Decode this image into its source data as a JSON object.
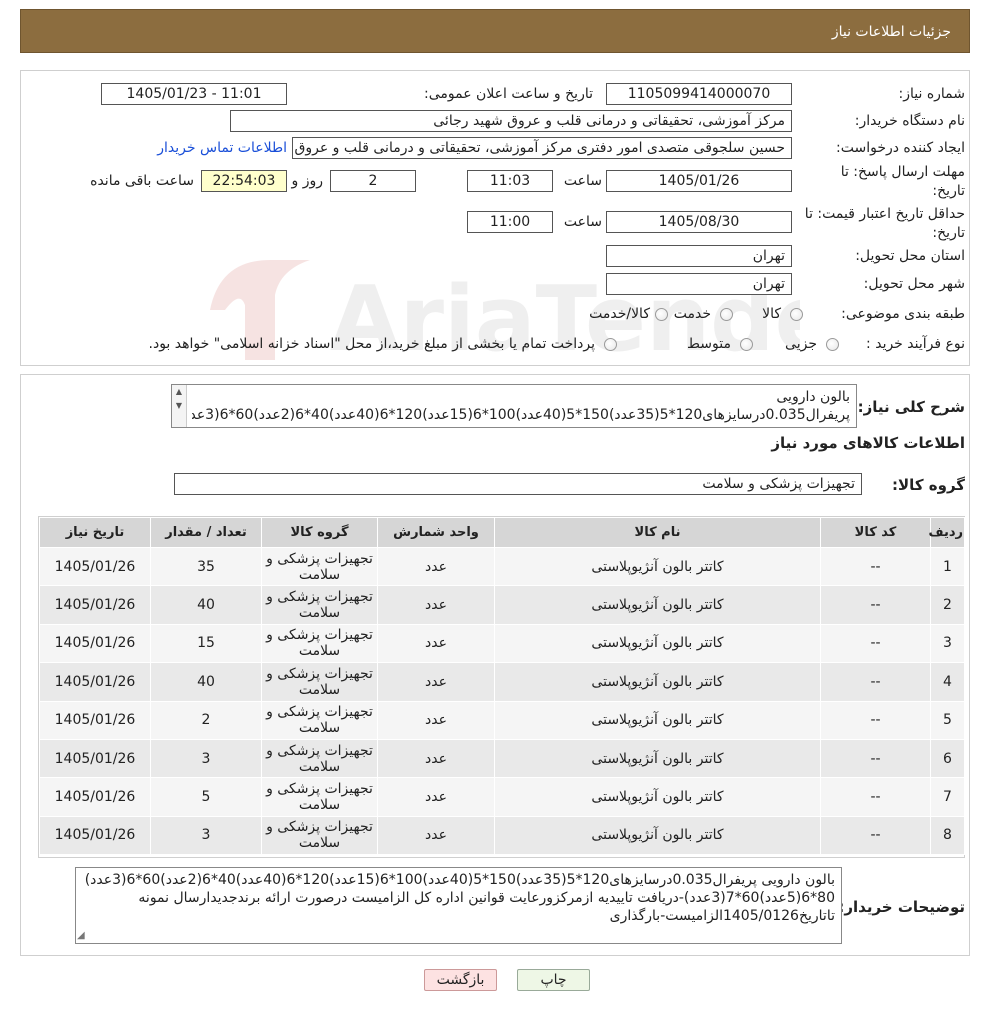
{
  "header": {
    "title": "جزئیات اطلاعات نیاز"
  },
  "info": {
    "need_number_label": "شماره نیاز:",
    "need_number": "1105099414000070",
    "announce_label": "تاریخ و ساعت اعلان عمومی:",
    "announce_value": "1405/01/23 - 11:01",
    "buyer_org_label": "نام دستگاه خریدار:",
    "buyer_org": "مرکز آموزشی، تحقیقاتی و درمانی قلب و عروق شهید رجائی",
    "creator_label": "ایجاد کننده درخواست:",
    "creator": "حسین سلجوقی متصدی امور دفتری مرکز آموزشی، تحقیقاتی و درمانی قلب و عروق",
    "contact_link": "اطلاعات تماس خریدار",
    "deadline_label_1": "مهلت ارسال پاسخ: تا",
    "deadline_label_2": "تاریخ:",
    "deadline_date": "1405/01/26",
    "time_label": "ساعت",
    "deadline_time": "11:03",
    "days_value": "2",
    "days_label": "روز و",
    "remaining_value": "22:54:03",
    "remaining_label": "ساعت باقی مانده",
    "validity_label_1": "حداقل تاریخ اعتبار قیمت: تا",
    "validity_label_2": "تاریخ:",
    "validity_date": "1405/08/30",
    "validity_time": "11:00",
    "province_label": "استان محل تحویل:",
    "province": "تهران",
    "city_label": "شهر محل تحویل:",
    "city": "تهران",
    "category_label": "طبقه بندی موضوعی:",
    "category_options": [
      "کالا",
      "خدمت",
      "کالا/خدمت"
    ],
    "process_label": "نوع فرآیند خرید :",
    "process_options": [
      "جزیی",
      "متوسط"
    ],
    "process_note": "پرداخت تمام یا بخشی از مبلغ خرید،از محل \"اسناد خزانه اسلامی\" خواهد بود."
  },
  "summary": {
    "label": "شرح کلی نیاز:",
    "line1": "بالون دارویی",
    "line2": "پریفرال0.035درسایزهای120*5(35عدد)150*5(40عدد)100*6(15عدد)120*6(40عدد)40*6(2عدد)60*6(3عد",
    "goods_info_title": "اطلاعات کالاهای مورد نیاز",
    "goods_group_label": "گروه کالا:",
    "goods_group": "تجهیزات پزشکی و سلامت"
  },
  "table": {
    "headers": [
      "ردیف",
      "کد کالا",
      "نام کالا",
      "واحد شمارش",
      "گروه کالا",
      "تعداد / مقدار",
      "تاریخ نیاز"
    ],
    "rows": [
      {
        "idx": "1",
        "code": "--",
        "name": "کاتتر بالون آنژیوپلاستی",
        "unit": "عدد",
        "group": "تجهیزات پزشکی و سلامت",
        "qty": "35",
        "date": "1405/01/26"
      },
      {
        "idx": "2",
        "code": "--",
        "name": "کاتتر بالون آنژیوپلاستی",
        "unit": "عدد",
        "group": "تجهیزات پزشکی و سلامت",
        "qty": "40",
        "date": "1405/01/26"
      },
      {
        "idx": "3",
        "code": "--",
        "name": "کاتتر بالون آنژیوپلاستی",
        "unit": "عدد",
        "group": "تجهیزات پزشکی و سلامت",
        "qty": "15",
        "date": "1405/01/26"
      },
      {
        "idx": "4",
        "code": "--",
        "name": "کاتتر بالون آنژیوپلاستی",
        "unit": "عدد",
        "group": "تجهیزات پزشکی و سلامت",
        "qty": "40",
        "date": "1405/01/26"
      },
      {
        "idx": "5",
        "code": "--",
        "name": "کاتتر بالون آنژیوپلاستی",
        "unit": "عدد",
        "group": "تجهیزات پزشکی و سلامت",
        "qty": "2",
        "date": "1405/01/26"
      },
      {
        "idx": "6",
        "code": "--",
        "name": "کاتتر بالون آنژیوپلاستی",
        "unit": "عدد",
        "group": "تجهیزات پزشکی و سلامت",
        "qty": "3",
        "date": "1405/01/26"
      },
      {
        "idx": "7",
        "code": "--",
        "name": "کاتتر بالون آنژیوپلاستی",
        "unit": "عدد",
        "group": "تجهیزات پزشکی و سلامت",
        "qty": "5",
        "date": "1405/01/26"
      },
      {
        "idx": "8",
        "code": "--",
        "name": "کاتتر بالون آنژیوپلاستی",
        "unit": "عدد",
        "group": "تجهیزات پزشکی و سلامت",
        "qty": "3",
        "date": "1405/01/26"
      }
    ]
  },
  "buyer_notes": {
    "label": "توضیحات خریدار:",
    "line1": "بالون دارویی پریفرال0.035درسایزهای120*5(35عدد)150*5(40عدد)100*6(15عدد)120*6(40عدد)40*6(2عدد)60*6(3عدد)",
    "line2": "80*6(5عدد)60*7(3عدد)-دریافت تاییدیه ازمرکزورعایت قوانین اداره کل الزامیست درصورت ارائه برندجدیدارسال نمونه",
    "line3": "تاتاریخ1405/0126الزامیست-بارگذاری"
  },
  "buttons": {
    "print": "چاپ",
    "back": "بازگشت"
  },
  "watermark": {
    "text": "AriaTender.neT"
  },
  "colors": {
    "header_bg": "#8c6d3f",
    "link": "#1a4fd8",
    "remaining_bg": "#ffffcc",
    "back_btn_bg": "#fde2e2",
    "print_btn_bg": "#eef7e6"
  }
}
